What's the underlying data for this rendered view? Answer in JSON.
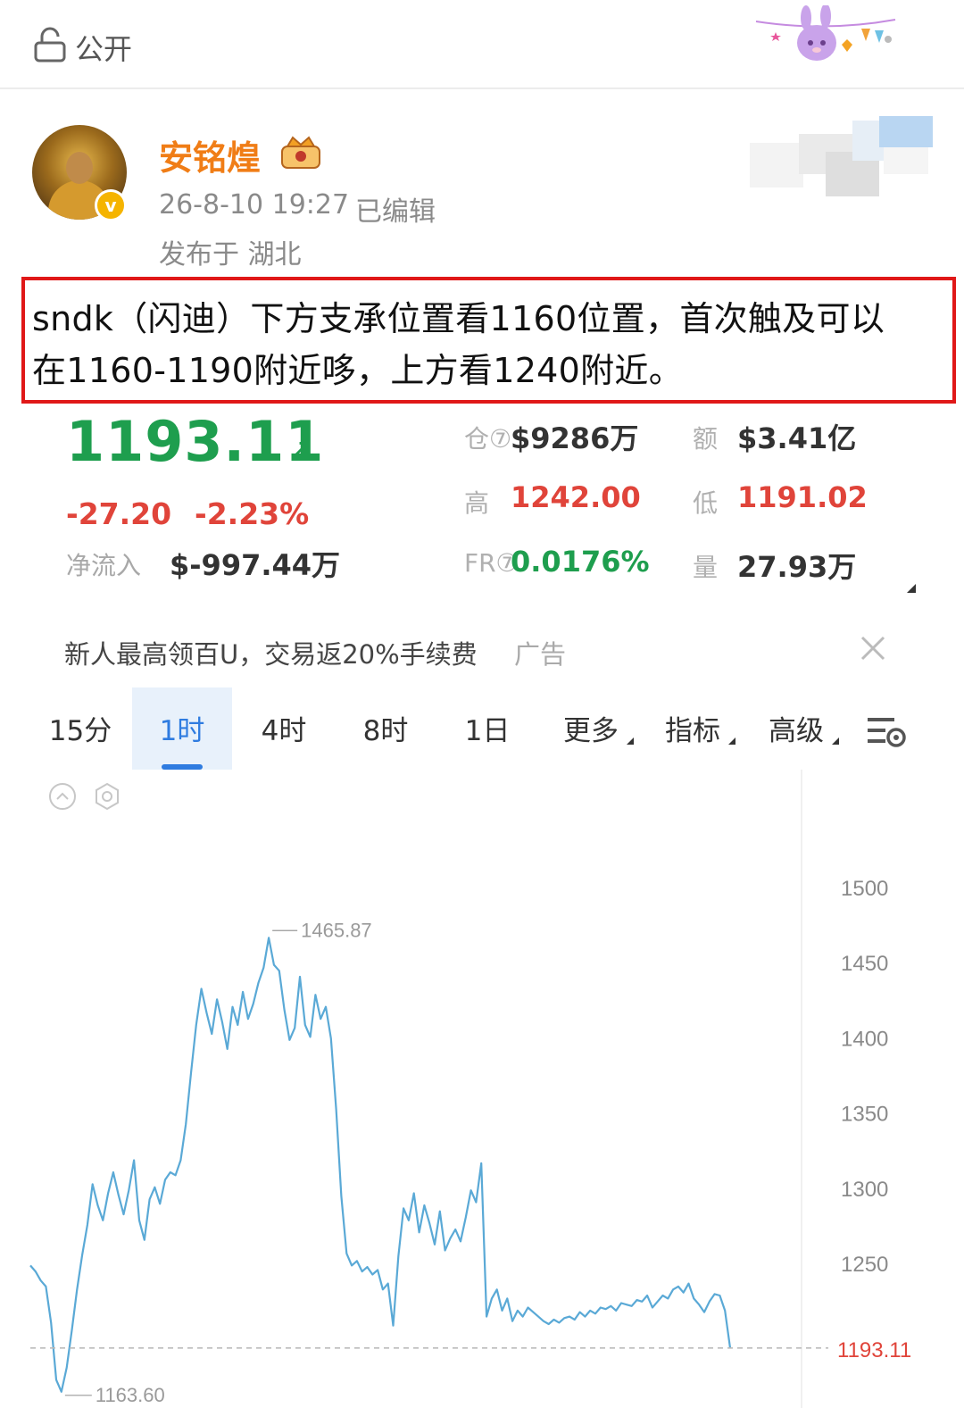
{
  "header": {
    "visibility_label": "公开",
    "lock_icon": "lock-icon",
    "decoration": "bunny-garland-decoration"
  },
  "post": {
    "author": "安铭煌",
    "badge_icon": "crown-badge-icon",
    "verified_icon": "v",
    "timestamp": "26-8-10 19:27",
    "edited": "已编辑",
    "location": "发布于 湖北",
    "text_line1": "sndk（闪迪）下方支承位置看1160位置，首次触及可以",
    "text_line2": "在1160-1190附近哆，上方看1240附近。"
  },
  "quote": {
    "price": "1193.11",
    "change": "-27.20",
    "change_pct": "-2.23%",
    "net_inflow_label": "净流入",
    "net_inflow": "$-997.44万",
    "stats": [
      {
        "label": "仓⑦",
        "value": "$9286万",
        "tone": "dark"
      },
      {
        "label": "额",
        "value": "$3.41亿",
        "tone": "dark"
      },
      {
        "label": "高",
        "value": "1242.00",
        "tone": "red"
      },
      {
        "label": "低",
        "value": "1191.02",
        "tone": "red"
      },
      {
        "label": "FR⑦",
        "value": "0.0176%",
        "tone": "green"
      },
      {
        "label": "量",
        "value": "27.93万",
        "tone": "dark"
      }
    ],
    "colors": {
      "up": "#1e9e4e",
      "down": "#e0443a"
    }
  },
  "ad": {
    "text": "新人最高领百U，交易返20%手续费",
    "tag": "广告"
  },
  "tabs": [
    {
      "label": "15分",
      "active": false,
      "dropdown": false
    },
    {
      "label": "1时",
      "active": true,
      "dropdown": false
    },
    {
      "label": "4时",
      "active": false,
      "dropdown": false
    },
    {
      "label": "8时",
      "active": false,
      "dropdown": false
    },
    {
      "label": "1日",
      "active": false,
      "dropdown": false
    },
    {
      "label": "更多",
      "active": false,
      "dropdown": true
    },
    {
      "label": "指标",
      "active": false,
      "dropdown": true
    },
    {
      "label": "高级",
      "active": false,
      "dropdown": true
    }
  ],
  "chart_data": {
    "type": "line",
    "y_ticks": [
      "1500",
      "1450",
      "1400",
      "1350",
      "1300",
      "1250"
    ],
    "ylim": [
      1163,
      1530
    ],
    "high_label": "1465.87",
    "low_label": "1163.60",
    "last_price_label": "1193.11",
    "color": "#5aa9d6",
    "values": [
      1248,
      1244,
      1238,
      1234,
      1210,
      1172,
      1164,
      1180,
      1205,
      1232,
      1255,
      1275,
      1302,
      1288,
      1278,
      1296,
      1310,
      1295,
      1282,
      1298,
      1318,
      1278,
      1265,
      1292,
      1300,
      1289,
      1305,
      1310,
      1308,
      1318,
      1342,
      1376,
      1408,
      1432,
      1416,
      1402,
      1425,
      1410,
      1392,
      1420,
      1408,
      1430,
      1412,
      1422,
      1436,
      1446,
      1466,
      1448,
      1444,
      1418,
      1398,
      1406,
      1440,
      1408,
      1400,
      1428,
      1412,
      1420,
      1399,
      1352,
      1294,
      1256,
      1248,
      1251,
      1244,
      1247,
      1242,
      1245,
      1232,
      1236,
      1208,
      1254,
      1286,
      1278,
      1296,
      1270,
      1288,
      1276,
      1262,
      1284,
      1258,
      1266,
      1272,
      1264,
      1280,
      1298,
      1290,
      1316,
      1214,
      1226,
      1232,
      1218,
      1226,
      1211,
      1218,
      1214,
      1220,
      1217,
      1214,
      1211,
      1209,
      1212,
      1210,
      1213,
      1214,
      1212,
      1217,
      1214,
      1218,
      1216,
      1220,
      1219,
      1221,
      1218,
      1223,
      1222,
      1221,
      1225,
      1224,
      1228,
      1220,
      1224,
      1228,
      1226,
      1232,
      1234,
      1230,
      1236,
      1226,
      1222,
      1217,
      1224,
      1229,
      1228,
      1218,
      1193.11
    ]
  }
}
